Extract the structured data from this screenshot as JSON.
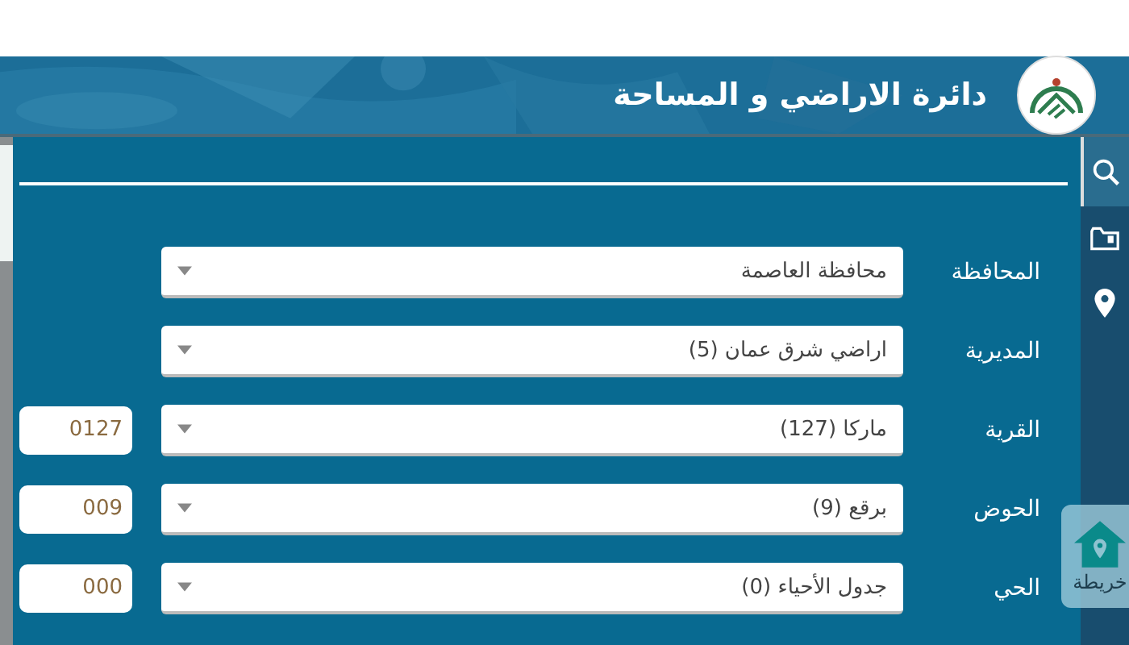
{
  "header": {
    "title": "دائرة الاراضي و المساحة"
  },
  "sidebar": {
    "items": [
      {
        "kind": "search",
        "selected": true
      },
      {
        "kind": "folder",
        "selected": false
      },
      {
        "kind": "pin",
        "selected": false
      }
    ]
  },
  "fields": [
    {
      "label": "المحافظة",
      "value": "محافظة العاصمة"
    },
    {
      "label": "المديرية",
      "value": "اراضي شرق عمان (5)"
    },
    {
      "label": "القرية",
      "value": "ماركا (127)",
      "code": "0127"
    },
    {
      "label": "الحوض",
      "value": "برقع (9)",
      "code": "009"
    },
    {
      "label": "الحي",
      "value": "جدول الأحياء (0)",
      "code": "000"
    }
  ],
  "map_button": {
    "label": "خريطة"
  }
}
